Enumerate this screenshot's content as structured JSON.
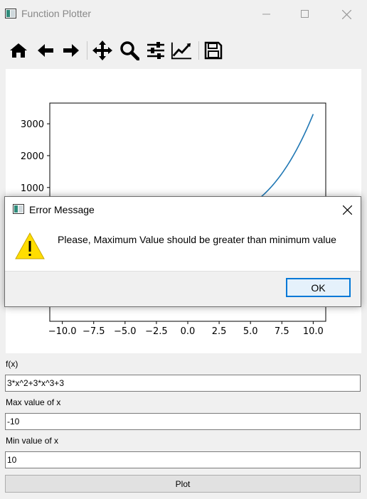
{
  "window": {
    "title": "Function Plotter"
  },
  "toolbar": {
    "tools": [
      {
        "icon": "home-icon"
      },
      {
        "icon": "back-arrow-icon"
      },
      {
        "icon": "forward-arrow-icon"
      },
      {
        "icon": "pan-icon"
      },
      {
        "icon": "zoom-icon"
      },
      {
        "icon": "subplots-config-icon"
      },
      {
        "icon": "edit-axes-icon"
      },
      {
        "icon": "save-icon"
      }
    ]
  },
  "chart_data": {
    "type": "line",
    "function": "3*x^2+3*x^3+3",
    "x_ticks": [
      "−10.0",
      "−7.5",
      "−5.0",
      "−2.5",
      "0.0",
      "2.5",
      "5.0",
      "7.5",
      "10.0"
    ],
    "y_ticks": [
      "1000",
      "2000",
      "3000"
    ],
    "xlim": [
      -11,
      11
    ],
    "ylim": [
      -3200,
      3650
    ],
    "line_color": "#1f77b4",
    "grid": false
  },
  "form": {
    "fx_label": "f(x)",
    "fx_value": "3*x^2+3*x^3+3",
    "max_label": "Max value of x",
    "max_value": "-10",
    "min_label": "Min value of x",
    "min_value": "10",
    "plot_label": "Plot"
  },
  "dialog": {
    "title": "Error Message",
    "message": "Please, Maximum Value should be greater than minimum value",
    "ok_label": "OK"
  }
}
